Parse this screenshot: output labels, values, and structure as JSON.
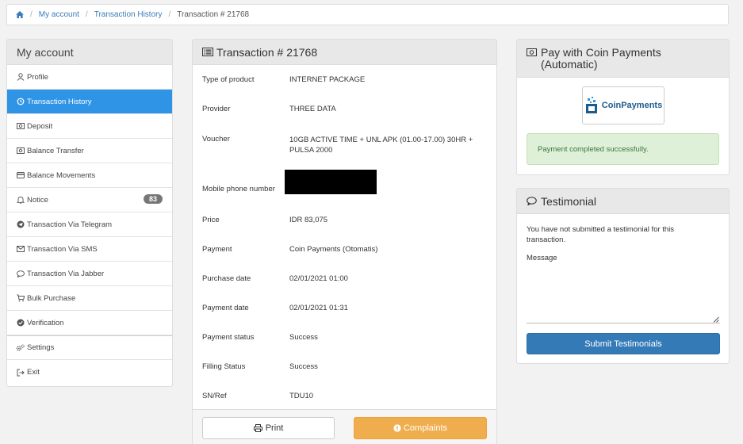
{
  "breadcrumb": {
    "home_icon": "home-icon",
    "items": [
      "My account",
      "Transaction History"
    ],
    "current": "Transaction # 21768"
  },
  "sidebar": {
    "title": "My account",
    "items": [
      {
        "label": "Profile",
        "icon": "user-icon"
      },
      {
        "label": "Transaction History",
        "icon": "history-icon",
        "active": true
      },
      {
        "label": "Deposit",
        "icon": "money-icon"
      },
      {
        "label": "Balance Transfer",
        "icon": "money-icon"
      },
      {
        "label": "Balance Movements",
        "icon": "credit-card-icon"
      },
      {
        "label": "Notice",
        "icon": "bell-icon",
        "badge": "83"
      },
      {
        "label": "Transaction Via Telegram",
        "icon": "telegram-icon"
      },
      {
        "label": "Transaction Via SMS",
        "icon": "envelope-icon"
      },
      {
        "label": "Transaction Via Jabber",
        "icon": "comment-icon"
      },
      {
        "label": "Bulk Purchase",
        "icon": "cart-icon"
      },
      {
        "label": "Verification",
        "icon": "check-circle-icon"
      },
      {
        "label": "Settings",
        "icon": "gears-icon"
      },
      {
        "label": "Exit",
        "icon": "sign-out-icon"
      }
    ]
  },
  "transaction": {
    "title": "Transaction # 21768",
    "rows": [
      {
        "label": "Type of product",
        "value": "INTERNET PACKAGE"
      },
      {
        "label": "Provider",
        "value": "THREE DATA"
      },
      {
        "label": "Voucher",
        "value": "10GB ACTIVE TIME + UNL APK (01.00-17.00) 30HR + PULSA 2000"
      },
      {
        "label": "Mobile phone number",
        "value": ""
      },
      {
        "label": "Price",
        "value": "IDR 83,075"
      },
      {
        "label": "Payment",
        "value": "Coin Payments (Otomatis)"
      },
      {
        "label": "Purchase date",
        "value": "02/01/2021 01:00"
      },
      {
        "label": "Payment date",
        "value": "02/01/2021 01:31"
      },
      {
        "label": "Payment status",
        "value": "Success"
      },
      {
        "label": "Filling Status",
        "value": "Success"
      },
      {
        "label": "SN/Ref",
        "value": "TDU10"
      }
    ],
    "print_label": "Print",
    "complaints_label": "Complaints"
  },
  "payment": {
    "title": "Pay with Coin Payments (Automatic)",
    "logo_text": "CoinPayments",
    "status_message": "Payment completed successfully."
  },
  "testimonial": {
    "title": "Testimonial",
    "notice": "You have not submitted a testimonial for this transaction.",
    "message_label": "Message",
    "submit_label": "Submit Testimonials"
  },
  "colors": {
    "active_item": "#2f93e6",
    "submit_button": "#337ab7",
    "complaints_button": "#f0ad4e",
    "success_bg": "#dff0d8",
    "success_text": "#3c763d"
  }
}
